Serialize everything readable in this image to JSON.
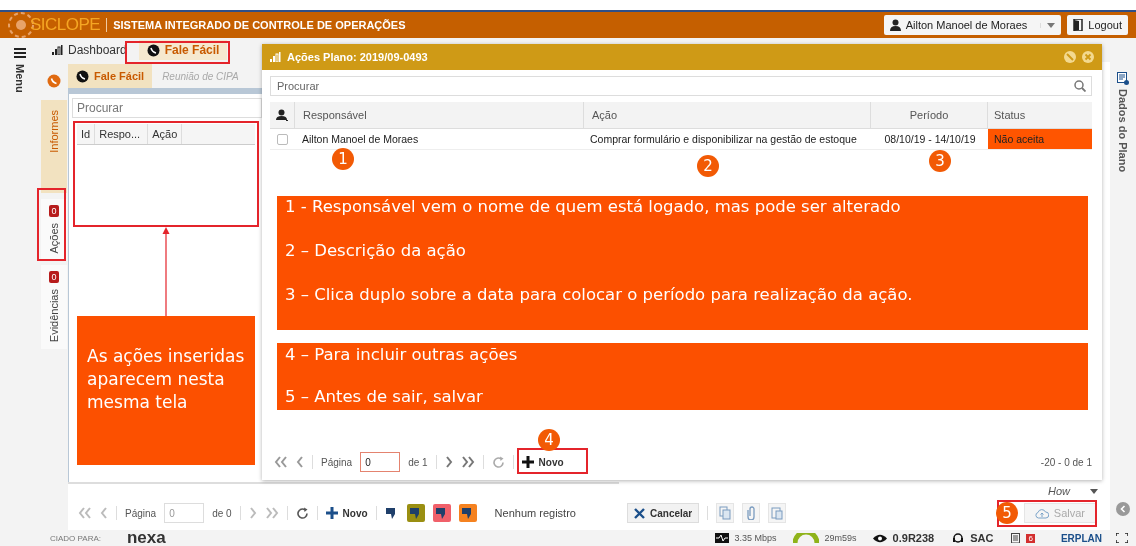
{
  "header": {
    "logo": "SICLOPE",
    "title": "SISTEMA INTEGRADO DE CONTROLE DE OPERAÇÕES",
    "user": "Ailton Manoel de Moraes",
    "logout": "Logout"
  },
  "menu_label": "Menu",
  "main_tabs": [
    {
      "label": "Dashboard",
      "selected": false,
      "kind": "chart"
    },
    {
      "label": "Fale Fácil",
      "selected": true,
      "kind": "chat"
    }
  ],
  "side_tabs": [
    {
      "label": "Informes",
      "selected": true
    },
    {
      "label": "Ações",
      "badge": "0",
      "selected": false
    },
    {
      "label": "Evidências",
      "badge": "0",
      "selected": false
    }
  ],
  "inner_panel": {
    "tabs": [
      {
        "label": "Fale Fácil",
        "selected": true
      },
      {
        "label": "Reunião de CIPA",
        "selected": false
      }
    ],
    "search": {
      "placeholder": "Procurar"
    },
    "columns": [
      "Id",
      "Respo...",
      "Ação"
    ]
  },
  "bottom_toolbar": {
    "page_label": "Página",
    "page": "0",
    "page_of": "de 0",
    "new": "Novo",
    "flag_buttons": [
      {
        "kind": "plain"
      },
      {
        "kind": "filled",
        "color": "#9a8f12"
      },
      {
        "kind": "filled",
        "color": "#f0606a"
      },
      {
        "kind": "filled",
        "color": "#f58220"
      }
    ],
    "status": "Nenhum registro"
  },
  "form_actions": {
    "select": "How",
    "cancel": "Cancelar",
    "save": {
      "label": "Salvar",
      "disabled": true
    }
  },
  "right_panel": {
    "label": "Dados do Plano"
  },
  "status_bar": {
    "licensed": "CIADO PARA:",
    "brand": "nexa",
    "speed": "3.35 Mbps",
    "timer": "29m59s",
    "version": "0.9R238",
    "support": "SAC",
    "count": "6",
    "product": "ERPLAN"
  },
  "dialog": {
    "title": "Ações Plano: 2019/09-0493",
    "search": {
      "placeholder": "Procurar"
    },
    "columns": [
      "Responsável",
      "Ação",
      "Período",
      "Status"
    ],
    "rows": [
      {
        "selected": false,
        "responsible": "Ailton Manoel de Moraes",
        "action": "Comprar formulário e disponibilizar na gestão de estoque",
        "period": "08/10/19 - 14/10/19",
        "status": "Não aceita"
      }
    ],
    "pager": {
      "page_label": "Página",
      "page": "0",
      "page_of": "de 1",
      "new": "Novo",
      "summary": "-20 - 0 de 1"
    }
  },
  "annotations": {
    "markers": [
      "1",
      "2",
      "3",
      "4",
      "5"
    ],
    "note_1": [
      "1 - Responsável vem o nome de quem está logado, mas pode ser alterado",
      "2 – Descrição da ação",
      "3 – Clica duplo sobre a data para colocar o período para realização da ação."
    ],
    "note_2": [
      "4 – Para incluir outras ações",
      "5 – Antes de sair, salvar"
    ],
    "side_note": "As ações inseridas aparecem nesta mesma tela"
  }
}
